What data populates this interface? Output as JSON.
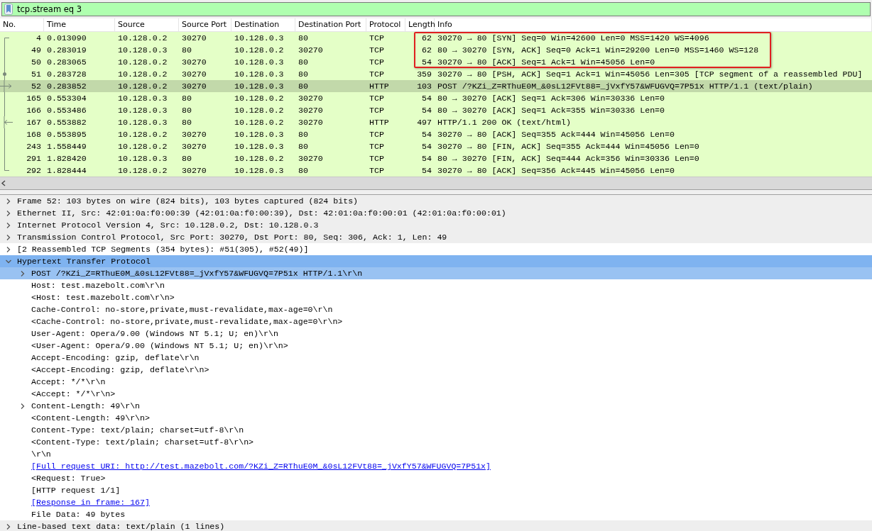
{
  "filter": {
    "value": "tcp.stream eq 3"
  },
  "packet_list": {
    "columns": [
      "No.",
      "Time",
      "Source",
      "Source Port",
      "Destination",
      "Destination Port",
      "Protocol",
      "Length",
      "Info"
    ],
    "rows": [
      {
        "cells": [
          "4",
          "0.013090",
          "10.128.0.2",
          "30270",
          "10.128.0.3",
          "80",
          "TCP",
          "62",
          "30270 → 80 [SYN] Seq=0 Win=42600 Len=0 MSS=1420 WS=4096"
        ],
        "selected": false,
        "boxed": true,
        "kind": "first"
      },
      {
        "cells": [
          "49",
          "0.283019",
          "10.128.0.3",
          "80",
          "10.128.0.2",
          "30270",
          "TCP",
          "62",
          "80 → 30270 [SYN, ACK] Seq=0 Ack=1 Win=29200 Len=0 MSS=1460 WS=128"
        ],
        "selected": false,
        "boxed": true,
        "kind": "line"
      },
      {
        "cells": [
          "50",
          "0.283065",
          "10.128.0.2",
          "30270",
          "10.128.0.3",
          "80",
          "TCP",
          "54",
          "30270 → 80 [ACK] Seq=1 Ack=1 Win=45056 Len=0"
        ],
        "selected": false,
        "boxed": true,
        "kind": "line"
      },
      {
        "cells": [
          "51",
          "0.283728",
          "10.128.0.2",
          "30270",
          "10.128.0.3",
          "80",
          "TCP",
          "359",
          "30270 → 80 [PSH, ACK] Seq=1 Ack=1 Win=45056 Len=305 [TCP segment of a reassembled PDU]"
        ],
        "selected": false,
        "boxed": false,
        "kind": "dot"
      },
      {
        "cells": [
          "52",
          "0.283852",
          "10.128.0.2",
          "30270",
          "10.128.0.3",
          "80",
          "HTTP",
          "103",
          "POST /?KZi_Z=RThuE0M_&0sL12FVt88=_jVxfY57&WFUGVQ=7P51x HTTP/1.1  (text/plain)"
        ],
        "selected": true,
        "boxed": false,
        "kind": "request"
      },
      {
        "cells": [
          "165",
          "0.553304",
          "10.128.0.3",
          "80",
          "10.128.0.2",
          "30270",
          "TCP",
          "54",
          "80 → 30270 [ACK] Seq=1 Ack=306 Win=30336 Len=0"
        ],
        "selected": false,
        "boxed": false,
        "kind": "line"
      },
      {
        "cells": [
          "166",
          "0.553486",
          "10.128.0.3",
          "80",
          "10.128.0.2",
          "30270",
          "TCP",
          "54",
          "80 → 30270 [ACK] Seq=1 Ack=355 Win=30336 Len=0"
        ],
        "selected": false,
        "boxed": false,
        "kind": "line"
      },
      {
        "cells": [
          "167",
          "0.553882",
          "10.128.0.3",
          "80",
          "10.128.0.2",
          "30270",
          "HTTP",
          "497",
          "HTTP/1.1 200 OK  (text/html)"
        ],
        "selected": false,
        "boxed": false,
        "kind": "response"
      },
      {
        "cells": [
          "168",
          "0.553895",
          "10.128.0.2",
          "30270",
          "10.128.0.3",
          "80",
          "TCP",
          "54",
          "30270 → 80 [ACK] Seq=355 Ack=444 Win=45056 Len=0"
        ],
        "selected": false,
        "boxed": false,
        "kind": "line"
      },
      {
        "cells": [
          "243",
          "1.558449",
          "10.128.0.2",
          "30270",
          "10.128.0.3",
          "80",
          "TCP",
          "54",
          "30270 → 80 [FIN, ACK] Seq=355 Ack=444 Win=45056 Len=0"
        ],
        "selected": false,
        "boxed": false,
        "kind": "line"
      },
      {
        "cells": [
          "291",
          "1.828420",
          "10.128.0.3",
          "80",
          "10.128.0.2",
          "30270",
          "TCP",
          "54",
          "80 → 30270 [FIN, ACK] Seq=444 Ack=356 Win=30336 Len=0"
        ],
        "selected": false,
        "boxed": false,
        "kind": "line"
      },
      {
        "cells": [
          "292",
          "1.828444",
          "10.128.0.2",
          "30270",
          "10.128.0.3",
          "80",
          "TCP",
          "54",
          "30270 → 80 [ACK] Seq=356 Ack=445 Win=45056 Len=0"
        ],
        "selected": false,
        "boxed": false,
        "kind": "last"
      }
    ]
  },
  "details": [
    {
      "text": "Frame 52: 103 bytes on wire (824 bits), 103 bytes captured (824 bits)",
      "expanded": false,
      "selected": false,
      "shaded": true
    },
    {
      "text": "Ethernet II, Src: 42:01:0a:f0:00:39 (42:01:0a:f0:00:39), Dst: 42:01:0a:f0:00:01 (42:01:0a:f0:00:01)",
      "expanded": false,
      "selected": false,
      "shaded": true
    },
    {
      "text": "Internet Protocol Version 4, Src: 10.128.0.2, Dst: 10.128.0.3",
      "expanded": false,
      "selected": false,
      "shaded": true
    },
    {
      "text": "Transmission Control Protocol, Src Port: 30270, Dst Port: 80, Seq: 306, Ack: 1, Len: 49",
      "expanded": false,
      "selected": false,
      "shaded": true
    },
    {
      "text": "[2 Reassembled TCP Segments (354 bytes): #51(305), #52(49)]",
      "expanded": false,
      "selected": false,
      "shaded": false
    },
    {
      "text": "Hypertext Transfer Protocol",
      "expanded": true,
      "selected": true,
      "shaded": false,
      "children": [
        {
          "text": "POST /?KZi_Z=RThuE0M_&0sL12FVt88=_jVxfY57&WFUGVQ=7P51x HTTP/1.1\\r\\n",
          "expanded": false,
          "selected": true,
          "kind": "field"
        },
        {
          "text": "Host: test.mazebolt.com\\r\\n",
          "selected": false,
          "kind": "field"
        },
        {
          "text": "<Host: test.mazebolt.com\\r\\n>",
          "selected": false,
          "kind": "field"
        },
        {
          "text": "Cache-Control: no-store,private,must-revalidate,max-age=0\\r\\n",
          "selected": false,
          "kind": "field"
        },
        {
          "text": "<Cache-Control: no-store,private,must-revalidate,max-age=0\\r\\n>",
          "selected": false,
          "kind": "field"
        },
        {
          "text": "User-Agent: Opera/9.00 (Windows NT 5.1; U; en)\\r\\n",
          "selected": false,
          "kind": "field"
        },
        {
          "text": "<User-Agent: Opera/9.00 (Windows NT 5.1; U; en)\\r\\n>",
          "selected": false,
          "kind": "field"
        },
        {
          "text": "Accept-Encoding: gzip, deflate\\r\\n",
          "selected": false,
          "kind": "field"
        },
        {
          "text": "<Accept-Encoding: gzip, deflate\\r\\n>",
          "selected": false,
          "kind": "field"
        },
        {
          "text": "Accept: */*\\r\\n",
          "selected": false,
          "kind": "field"
        },
        {
          "text": "<Accept: */*\\r\\n>",
          "selected": false,
          "kind": "field"
        },
        {
          "text": "Content-Length: 49\\r\\n",
          "expanded": false,
          "selected": false,
          "kind": "field"
        },
        {
          "text": "<Content-Length: 49\\r\\n>",
          "selected": false,
          "kind": "field"
        },
        {
          "text": "Content-Type: text/plain; charset=utf-8\\r\\n",
          "selected": false,
          "kind": "field"
        },
        {
          "text": "<Content-Type: text/plain; charset=utf-8\\r\\n>",
          "selected": false,
          "kind": "field"
        },
        {
          "text": "\\r\\n",
          "selected": false,
          "kind": "field"
        },
        {
          "text": "[Full request URI: http://test.mazebolt.com/?KZi_Z=RThuE0M_&0sL12FVt88=_jVxfY57&WFUGVQ=7P51x]",
          "selected": false,
          "kind": "link"
        },
        {
          "text": "<Request: True>",
          "selected": false,
          "kind": "field"
        },
        {
          "text": "[HTTP request 1/1]",
          "selected": false,
          "kind": "field"
        },
        {
          "text": "[Response in frame: 167]",
          "selected": false,
          "kind": "link"
        },
        {
          "text": "File Data: 49 bytes",
          "selected": false,
          "kind": "field"
        }
      ]
    },
    {
      "text": "Line-based text data: text/plain (1 lines)",
      "expanded": false,
      "selected": false,
      "shaded": true
    }
  ]
}
